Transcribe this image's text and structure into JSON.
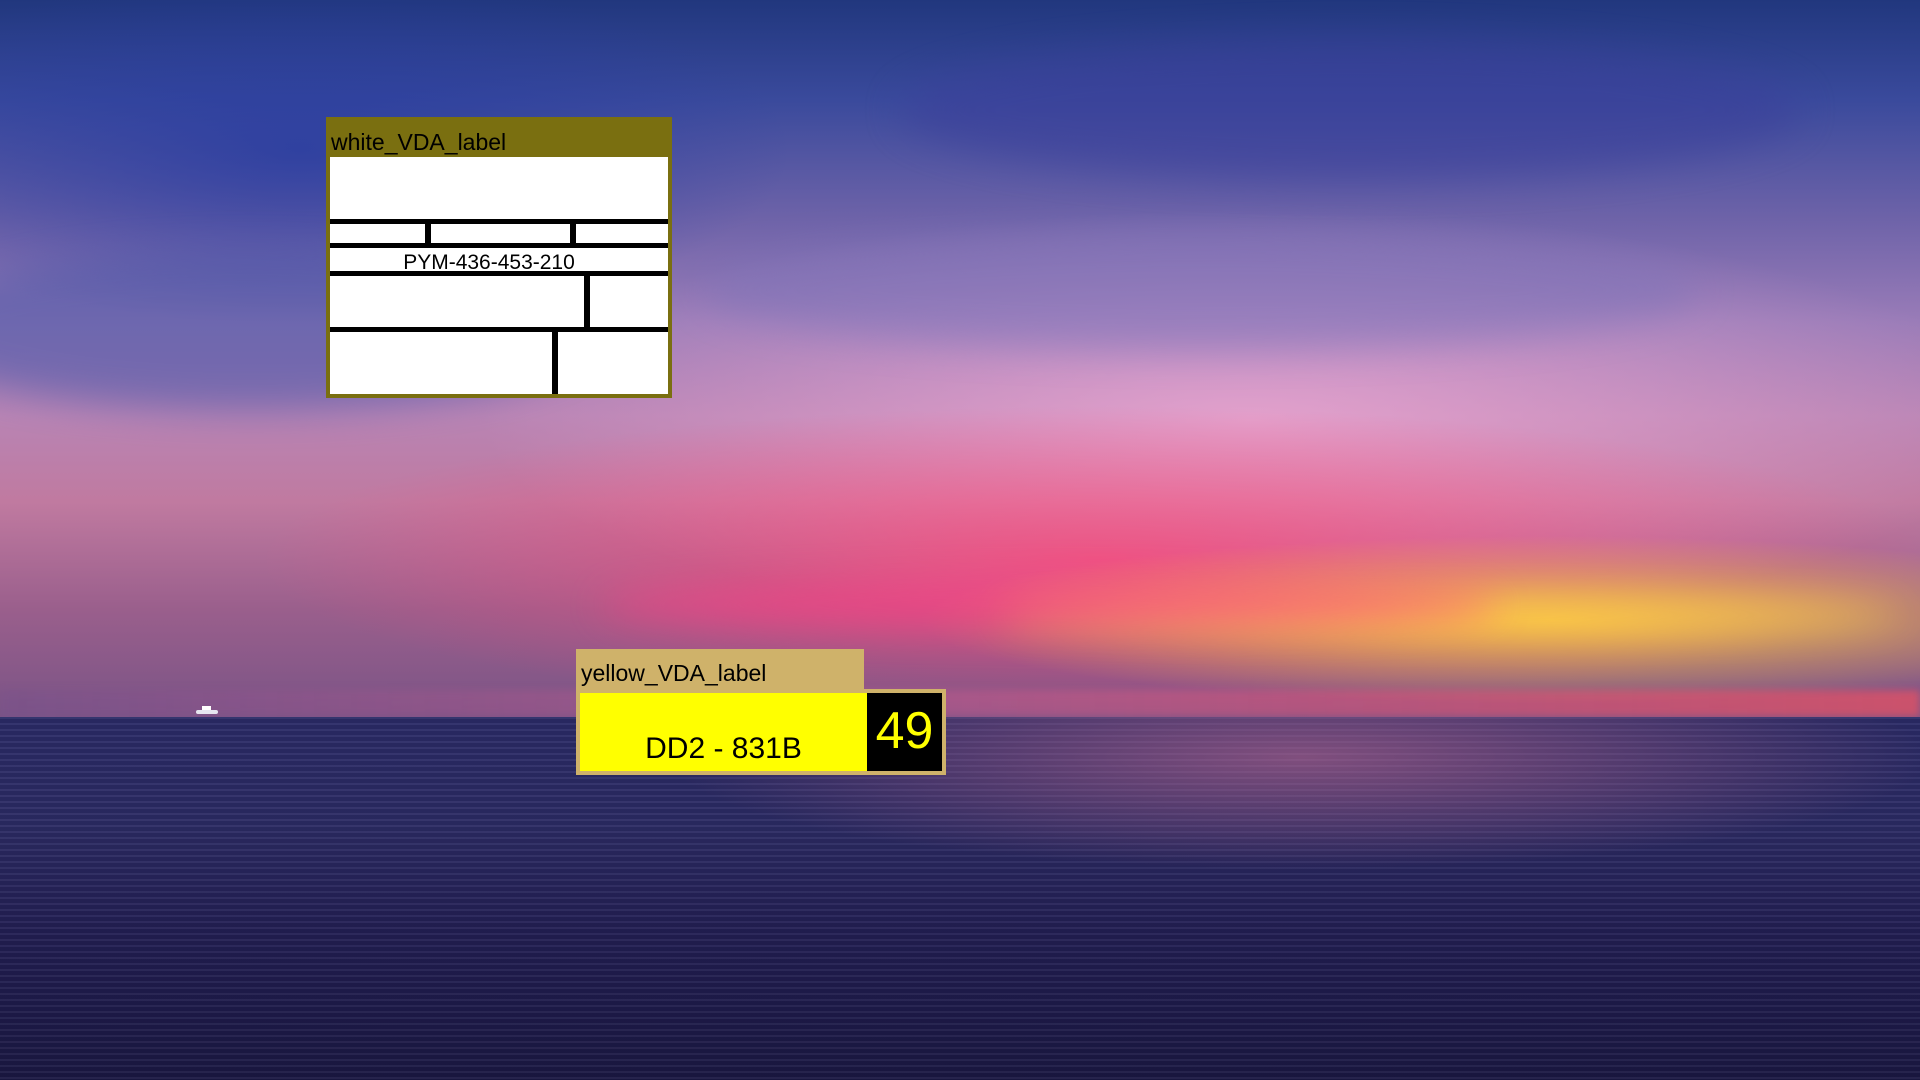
{
  "white_label": {
    "title": "white_VDA_label",
    "code": "PYM-436-453-210"
  },
  "yellow_label": {
    "title": "yellow_VDA_label",
    "plate": "DD2 - 831B",
    "number": "49"
  },
  "colors": {
    "white_label_frame": "#7a6f10",
    "yellow_label_frame": "#cfb26a",
    "yellow_fill": "#ffff00",
    "number_box": "#000000"
  }
}
